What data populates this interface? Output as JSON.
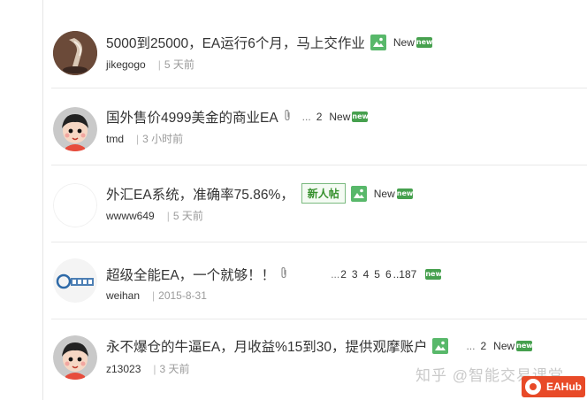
{
  "threads": [
    {
      "title": "5000到25000，EA运行6个月，马上交作业",
      "author": "jikegogo",
      "time": "5 天前",
      "new_label": "New",
      "new_badge": "new"
    },
    {
      "title": "国外售价4999美金的商业EA",
      "author": "tmd",
      "time": "3 小时前",
      "new_label": "New",
      "new_badge": "new",
      "pages": [
        "2"
      ]
    },
    {
      "title": "外汇EA系统，准确率75.86%，",
      "tag": "新人帖",
      "author": "wwww649",
      "time": "5 天前",
      "new_label": "New",
      "new_badge": "new"
    },
    {
      "title": "超级全能EA，一个就够！！",
      "author": "weihan",
      "time": "2015-8-31",
      "new_badge": "new",
      "pages": [
        "2",
        "3",
        "4",
        "5",
        "6",
        "..187"
      ]
    },
    {
      "title": "永不爆仓的牛逼EA，月收益%15到30，提供观摩账户",
      "author": "z13023",
      "time": "3 天前",
      "new_label": "New",
      "new_badge": "new",
      "pages": [
        "2"
      ]
    }
  ],
  "meta_separator": "|",
  "pages_ellipsis": "...",
  "watermark": {
    "text": "知乎 @智能交易课堂",
    "logo_text": "EAHub"
  },
  "colors": {
    "image_icon": "#58b86a",
    "new_badge": "#46a04e",
    "tag_border": "#7ab97f",
    "watermark_logo": "#e84a28"
  }
}
